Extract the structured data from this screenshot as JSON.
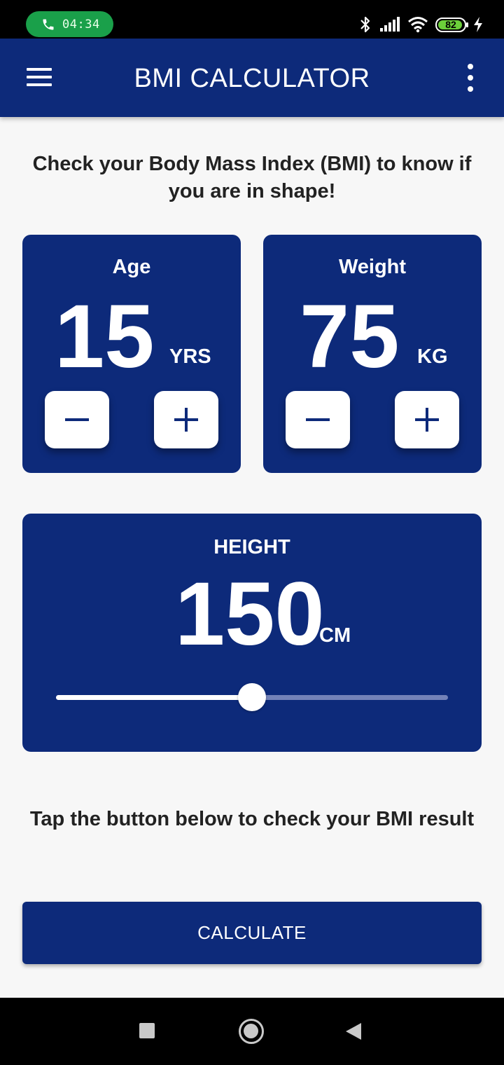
{
  "status_bar": {
    "time": "04:34",
    "battery_level": "82",
    "icons": [
      "phone-icon",
      "bluetooth-icon",
      "signal-icon",
      "wifi-icon",
      "battery-icon",
      "charging-icon"
    ]
  },
  "app_bar": {
    "title": "BMI CALCULATOR",
    "icons": [
      "menu-icon",
      "more-vertical-icon"
    ]
  },
  "intro_text": "Check your Body Mass Index (BMI) to know if you are in shape!",
  "age": {
    "label": "Age",
    "value": "15",
    "unit": "YRS"
  },
  "weight": {
    "label": "Weight",
    "value": "75",
    "unit": "KG"
  },
  "height": {
    "label": "HEIGHT",
    "value": "150",
    "unit": "CM",
    "slider_fraction": 0.5
  },
  "hint_text": "Tap the button below to check your BMI result",
  "calculate_label": "CALCULATE",
  "colors": {
    "primary": "#0d2a7a",
    "background": "#f7f7f7",
    "call_pill": "#1aa04a",
    "battery": "#6cd03a",
    "slider_inactive": "#7382b8"
  },
  "nav_bar": {
    "icons": [
      "recent-apps-icon",
      "home-icon",
      "back-icon"
    ]
  }
}
